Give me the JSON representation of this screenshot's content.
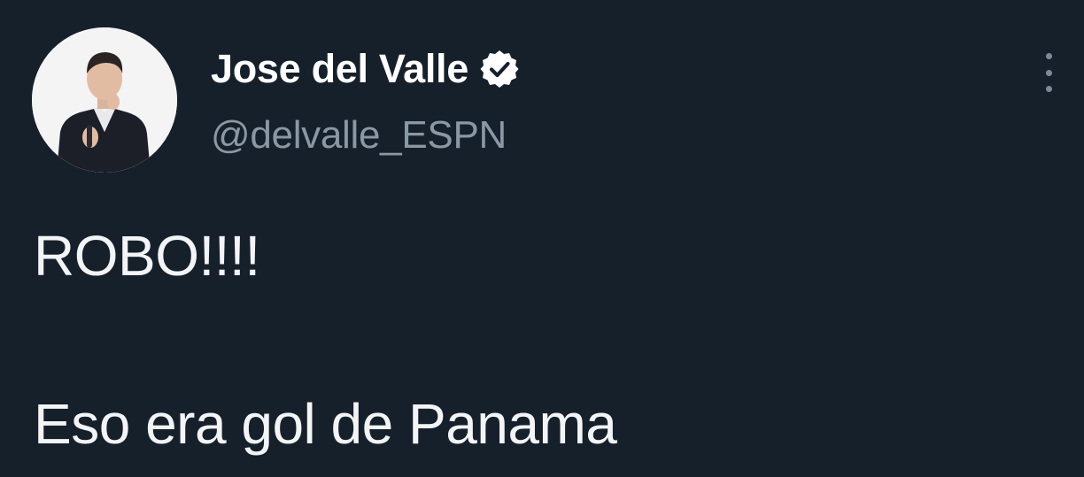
{
  "tweet": {
    "author": {
      "display_name": "Jose del Valle",
      "handle": "@delvalle_ESPN",
      "verified_icon": "verified-badge-icon",
      "avatar_icon": "profile-photo"
    },
    "more_icon": "more-options-icon",
    "text_lines": [
      "ROBO!!!!",
      "Eso era gol de Panama"
    ]
  },
  "colors": {
    "background": "#16202b",
    "text": "#f2f4f6",
    "handle": "#8a98a6"
  }
}
